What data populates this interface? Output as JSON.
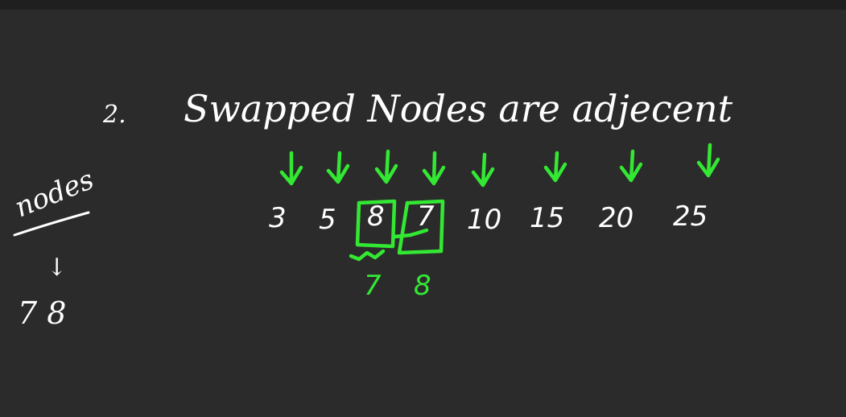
{
  "heading": {
    "number": "2.",
    "text": "Swapped Nodes are adjecent"
  },
  "sequence": [
    "3",
    "5",
    "8",
    "7",
    "10",
    "15",
    "20",
    "25"
  ],
  "swapped_fix": {
    "first": "7",
    "second": "8"
  },
  "side_note": {
    "label": "nodes",
    "arrow": "↓",
    "values": "7 8"
  },
  "colors": {
    "board": "#2b2b2b",
    "chalk": "#ffffff",
    "highlight": "#33e833"
  },
  "icons": [
    "down-arrow-icon",
    "swap-box-icon"
  ]
}
